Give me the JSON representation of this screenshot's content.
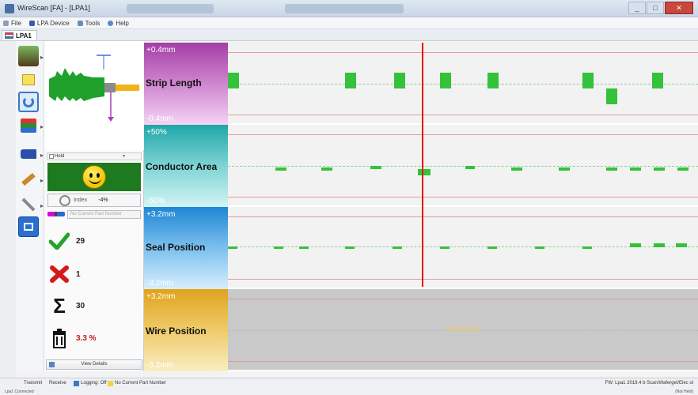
{
  "window": {
    "title": "WireScan [FA] - [LPA1]",
    "controls": [
      "_",
      "□",
      "✕"
    ]
  },
  "menu": {
    "items": [
      {
        "label": "File",
        "color": "#8aa0bb"
      },
      {
        "label": "LPA Device",
        "color": "#2f5fae"
      },
      {
        "label": "Tools",
        "color": "#6b8bbf"
      },
      {
        "label": "Help",
        "color": "#5b87c7"
      }
    ]
  },
  "tab": {
    "label": "LPA1"
  },
  "left_panel": {
    "held_label": "Held",
    "index_label": "Index",
    "index_value": "-4%",
    "part_number_placeholder": "No Current Part Number",
    "good_count": "29",
    "bad_count": "1",
    "total_count": "30",
    "scrap_percent": "3.3 %",
    "details_label": "View Details"
  },
  "channels": [
    {
      "name": "Strip Length",
      "top": "+0.4mm",
      "bottom": "-0.4mm",
      "color_top": "#b04cb0",
      "color_bottom": "#f2c8f2"
    },
    {
      "name": "Conductor Area",
      "top": "+50%",
      "bottom": "-50%",
      "color_top": "#27b1b3",
      "color_bottom": "#c9f0f0"
    },
    {
      "name": "Seal Position",
      "top": "+3.2mm",
      "bottom": "-3.2mm",
      "color_top": "#2a8fd6",
      "color_bottom": "#cfe9fb"
    },
    {
      "name": "Wire Position",
      "top": "+3.2mm",
      "bottom": "-3.2mm",
      "color_top": "#e3aa22",
      "color_bottom": "#f7e4a5"
    }
  ],
  "disabled_text": "DISABLED",
  "status": {
    "items": [
      "Transmit",
      "Receive",
      "Logging: Off",
      "No Current Part Number"
    ],
    "right_text": "FW: Lpa1 2019.4 b  Scan/Wafergel/Elec ol",
    "left_sub": "Lpa1 Connected",
    "right_sub": "(Not Held)"
  },
  "colors": {
    "accent_green": "#33c23a",
    "limit_red": "#e99a9a",
    "cursor_red": "#e21515"
  }
}
